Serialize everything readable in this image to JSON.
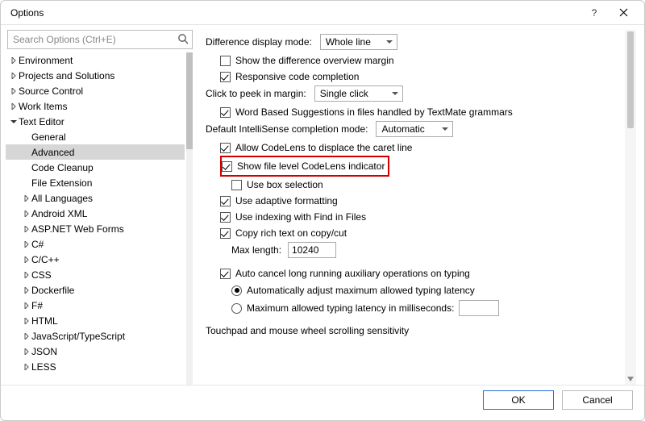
{
  "window": {
    "title": "Options"
  },
  "search": {
    "placeholder": "Search Options (Ctrl+E)"
  },
  "tree": {
    "items": [
      {
        "label": "Environment",
        "level": 0,
        "caret": "right"
      },
      {
        "label": "Projects and Solutions",
        "level": 0,
        "caret": "right"
      },
      {
        "label": "Source Control",
        "level": 0,
        "caret": "right"
      },
      {
        "label": "Work Items",
        "level": 0,
        "caret": "right"
      },
      {
        "label": "Text Editor",
        "level": 0,
        "caret": "down"
      },
      {
        "label": "General",
        "level": 1,
        "caret": "none"
      },
      {
        "label": "Advanced",
        "level": 1,
        "caret": "none",
        "selected": true
      },
      {
        "label": "Code Cleanup",
        "level": 1,
        "caret": "none"
      },
      {
        "label": "File Extension",
        "level": 1,
        "caret": "none"
      },
      {
        "label": "All Languages",
        "level": 1,
        "caret": "right"
      },
      {
        "label": "Android XML",
        "level": 1,
        "caret": "right"
      },
      {
        "label": "ASP.NET Web Forms",
        "level": 1,
        "caret": "right"
      },
      {
        "label": "C#",
        "level": 1,
        "caret": "right"
      },
      {
        "label": "C/C++",
        "level": 1,
        "caret": "right"
      },
      {
        "label": "CSS",
        "level": 1,
        "caret": "right"
      },
      {
        "label": "Dockerfile",
        "level": 1,
        "caret": "right"
      },
      {
        "label": "F#",
        "level": 1,
        "caret": "right"
      },
      {
        "label": "HTML",
        "level": 1,
        "caret": "right"
      },
      {
        "label": "JavaScript/TypeScript",
        "level": 1,
        "caret": "right"
      },
      {
        "label": "JSON",
        "level": 1,
        "caret": "right"
      },
      {
        "label": "LESS",
        "level": 1,
        "caret": "right"
      }
    ]
  },
  "settings": {
    "diff_mode_label": "Difference display mode:",
    "diff_mode_value": "Whole line",
    "show_diff_overview": {
      "label": "Show the difference overview margin",
      "checked": false
    },
    "responsive_completion": {
      "label": "Responsive code completion",
      "checked": true
    },
    "click_peek_label": "Click to peek in margin:",
    "click_peek_value": "Single click",
    "word_based": {
      "label": "Word Based Suggestions in files handled by TextMate grammars",
      "checked": true
    },
    "intellisense_label": "Default IntelliSense completion mode:",
    "intellisense_value": "Automatic",
    "allow_codelens_displace": {
      "label": "Allow CodeLens to displace the caret line",
      "checked": true
    },
    "show_file_level_codelens": {
      "label": "Show file level CodeLens indicator",
      "checked": true
    },
    "use_box_selection": {
      "label": "Use box selection",
      "checked": false
    },
    "use_adaptive_formatting": {
      "label": "Use adaptive formatting",
      "checked": true
    },
    "use_indexing_fif": {
      "label": "Use indexing with Find in Files",
      "checked": true
    },
    "copy_rich_text": {
      "label": "Copy rich text on copy/cut",
      "checked": true
    },
    "max_length_label": "Max length:",
    "max_length_value": "10240",
    "auto_cancel": {
      "label": "Auto cancel long running auxiliary operations on typing",
      "checked": true
    },
    "latency_auto": "Automatically adjust maximum allowed typing latency",
    "latency_manual": "Maximum allowed typing latency in milliseconds:",
    "latency_selected": "auto",
    "latency_manual_value": "",
    "touchpad_heading": "Touchpad and mouse wheel scrolling sensitivity"
  },
  "footer": {
    "ok": "OK",
    "cancel": "Cancel"
  }
}
